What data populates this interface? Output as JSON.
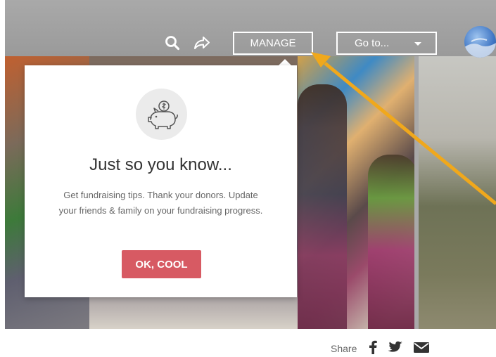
{
  "toolbar": {
    "manage_label": "MANAGE",
    "goto_label": "Go to...",
    "search_icon": "search-icon",
    "share_icon": "share-arrow-icon",
    "avatar_icon": "avatar"
  },
  "popup": {
    "icon": "piggy-bank-icon",
    "title": "Just so you know...",
    "body": "Get fundraising tips. Thank your donors. Update your friends & family on your fundraising progress.",
    "button_label": "OK, COOL"
  },
  "share": {
    "label": "Share",
    "icons": [
      "facebook-icon",
      "twitter-icon",
      "email-icon"
    ]
  },
  "colors": {
    "topbar": "#a3a3a3",
    "accent_button": "#d75a63",
    "annotation_arrow": "#f0a81c"
  }
}
